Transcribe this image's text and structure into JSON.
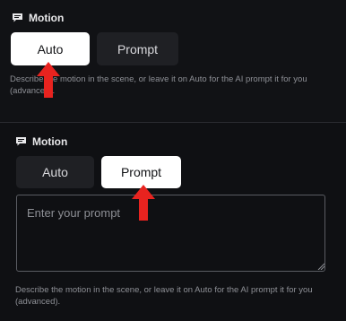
{
  "colors": {
    "background": "#111215",
    "active_button_bg": "#ffffff",
    "inactive_button_bg": "#1f2024",
    "annotation_arrow": "#e8231f",
    "description_text": "#8e9096"
  },
  "top_panel": {
    "header": {
      "icon": "message-icon",
      "title": "Motion"
    },
    "toggle": {
      "options": [
        "Auto",
        "Prompt"
      ],
      "selected": "Auto"
    },
    "description": "Describe the motion in the scene, or leave it on Auto for the AI prompt it for you (advanced).",
    "annotation": "red-arrow-pointing-to-auto"
  },
  "bottom_panel": {
    "header": {
      "icon": "message-icon",
      "title": "Motion"
    },
    "toggle": {
      "options": [
        "Auto",
        "Prompt"
      ],
      "selected": "Prompt"
    },
    "prompt_input": {
      "value": "",
      "placeholder": "Enter your prompt"
    },
    "description": "Describe the motion in the scene, or leave it on Auto for the AI prompt it for you (advanced).",
    "annotation": "red-arrow-pointing-to-prompt"
  }
}
